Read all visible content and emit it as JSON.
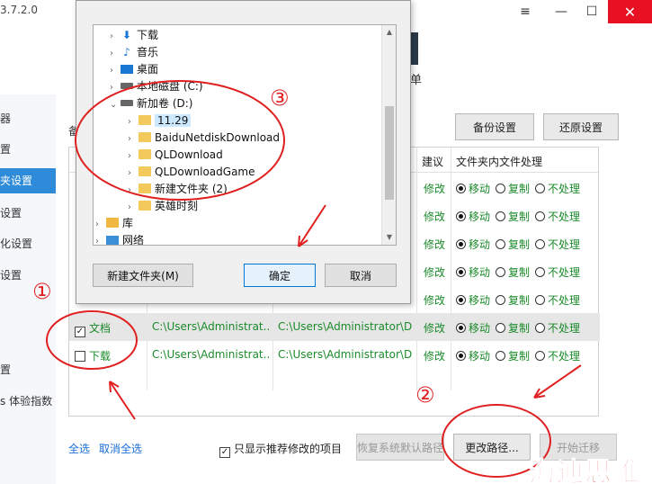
{
  "app": {
    "version_fragment": "3.7.2.0",
    "toolbar_fragment": "单",
    "win_menu": "≡",
    "win_min": "—",
    "win_max": "☐",
    "win_close": "✕"
  },
  "sidebar": {
    "items": [
      {
        "label": "器"
      },
      {
        "label": "置"
      },
      {
        "label": "夹设置"
      },
      {
        "label": "设置"
      },
      {
        "label": "化设置"
      },
      {
        "label": "设置"
      },
      {
        "label": "置"
      },
      {
        "label": "s 体验指数"
      }
    ]
  },
  "content": {
    "frag_label": "备",
    "backup_button": "备份设置",
    "restore_button": "还原设置",
    "headers": {
      "suggest": "建议",
      "handling": "文件夹内文件处理"
    },
    "options": {
      "move": "移动",
      "copy": "复制",
      "none": "不处理"
    },
    "rows": [
      {
        "name": "",
        "path_from": "",
        "path_to": "",
        "suggest": "修改",
        "selected": false,
        "checked": false
      },
      {
        "name": "",
        "path_from": "",
        "path_to": "",
        "suggest": "修改",
        "selected": false,
        "checked": false
      },
      {
        "name": "",
        "path_from": "",
        "path_to": "",
        "suggest": "修改",
        "selected": false,
        "checked": false
      },
      {
        "name": "",
        "path_from": "",
        "path_to": "",
        "suggest": "修改",
        "selected": false,
        "checked": false
      },
      {
        "name": "",
        "path_from": "",
        "path_to": "",
        "suggest": "修改",
        "selected": false,
        "checked": false
      },
      {
        "name": "文档",
        "path_from": "C:\\Users\\Administrat...",
        "path_to": "C:\\Users\\Administrator\\D...",
        "suggest": "修改",
        "selected": true,
        "checked": true
      },
      {
        "name": "下载",
        "path_from": "C:\\Users\\Administrat...",
        "path_to": "C:\\Users\\Administrator\\D...",
        "suggest": "修改",
        "selected": false,
        "checked": false
      }
    ],
    "select_all": "全选",
    "deselect_all": "取消全选",
    "only_recommended": "只显示推荐修改的项目",
    "restore_default": "恢复系统默认路径",
    "change_path": "更改路径...",
    "start_migrate": "开始迁移"
  },
  "dialog": {
    "tree": [
      {
        "label": "下载",
        "icon": "download-icon",
        "depth": 1
      },
      {
        "label": "音乐",
        "icon": "music-icon",
        "depth": 1
      },
      {
        "label": "桌面",
        "icon": "desktop-icon",
        "depth": 1
      },
      {
        "label": "本地磁盘 (C:)",
        "icon": "drive-icon",
        "depth": 1
      },
      {
        "label": "新加卷 (D:)",
        "icon": "drive-icon",
        "depth": 1,
        "expanded": true
      },
      {
        "label": "11.29",
        "icon": "folder-icon",
        "depth": 2,
        "selected": true
      },
      {
        "label": "BaiduNetdiskDownload",
        "icon": "folder-icon",
        "depth": 2
      },
      {
        "label": "QLDownload",
        "icon": "folder-icon",
        "depth": 2
      },
      {
        "label": "QLDownloadGame",
        "icon": "folder-icon",
        "depth": 2
      },
      {
        "label": "新建文件夹 (2)",
        "icon": "folder-icon",
        "depth": 2
      },
      {
        "label": "英雄时刻",
        "icon": "folder-icon",
        "depth": 2
      },
      {
        "label": "库",
        "icon": "library-icon",
        "depth": 0
      },
      {
        "label": "网络",
        "icon": "network-icon",
        "depth": 0
      }
    ],
    "new_folder": "新建文件夹(M)",
    "ok": "确定",
    "cancel": "取消"
  },
  "annotations": {
    "marker_1": "①",
    "marker_2": "②",
    "marker_3": "③",
    "watermark": "海迪思维",
    "color": "#e02020"
  }
}
